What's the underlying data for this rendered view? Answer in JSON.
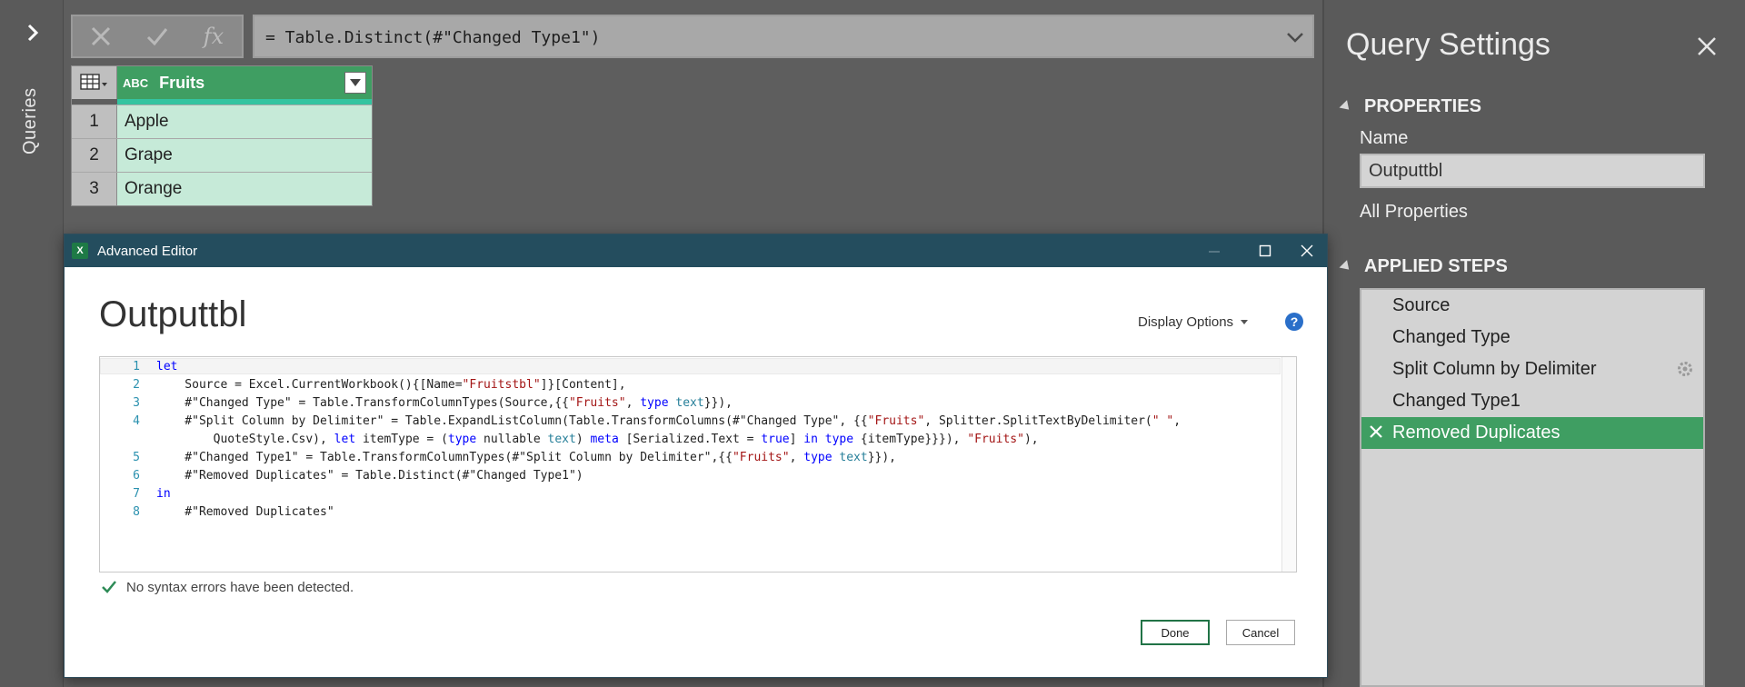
{
  "rail": {
    "label": "Queries",
    "expand_icon": "chevron-right-icon"
  },
  "formula_bar": {
    "cancel_icon": "close-icon",
    "commit_icon": "check-icon",
    "fx_label": "fx",
    "formula": "= Table.Distinct(#\"Changed Type1\")"
  },
  "grid": {
    "column_type_label": "ABC",
    "column_name": "Fruits",
    "rows": [
      {
        "num": "1",
        "value": "Apple"
      },
      {
        "num": "2",
        "value": "Grape"
      },
      {
        "num": "3",
        "value": "Orange"
      }
    ]
  },
  "query_settings": {
    "title": "Query Settings",
    "properties_heading": "PROPERTIES",
    "name_label": "Name",
    "name_value": "Outputtbl",
    "all_properties": "All Properties",
    "applied_steps_heading": "APPLIED STEPS",
    "steps": [
      {
        "label": "Source"
      },
      {
        "label": "Changed Type"
      },
      {
        "label": "Split Column by Delimiter"
      },
      {
        "label": "Changed Type1"
      },
      {
        "label": "Removed Duplicates"
      }
    ]
  },
  "advanced_editor": {
    "window_title": "Advanced Editor",
    "app_icon_letter": "X",
    "query_name": "Outputtbl",
    "display_options": "Display Options",
    "help_label": "?",
    "line_numbers": [
      "1",
      "2",
      "3",
      "4",
      "5",
      "6",
      "7",
      "8"
    ],
    "status": "No syntax errors have been detected.",
    "done_label": "Done",
    "cancel_label": "Cancel"
  },
  "colors": {
    "accent_green": "#3f9e62",
    "dialog_titlebar": "#244d5e",
    "keyword_blue": "#0000ff",
    "string_red": "#a31515",
    "type_teal": "#267f99"
  }
}
